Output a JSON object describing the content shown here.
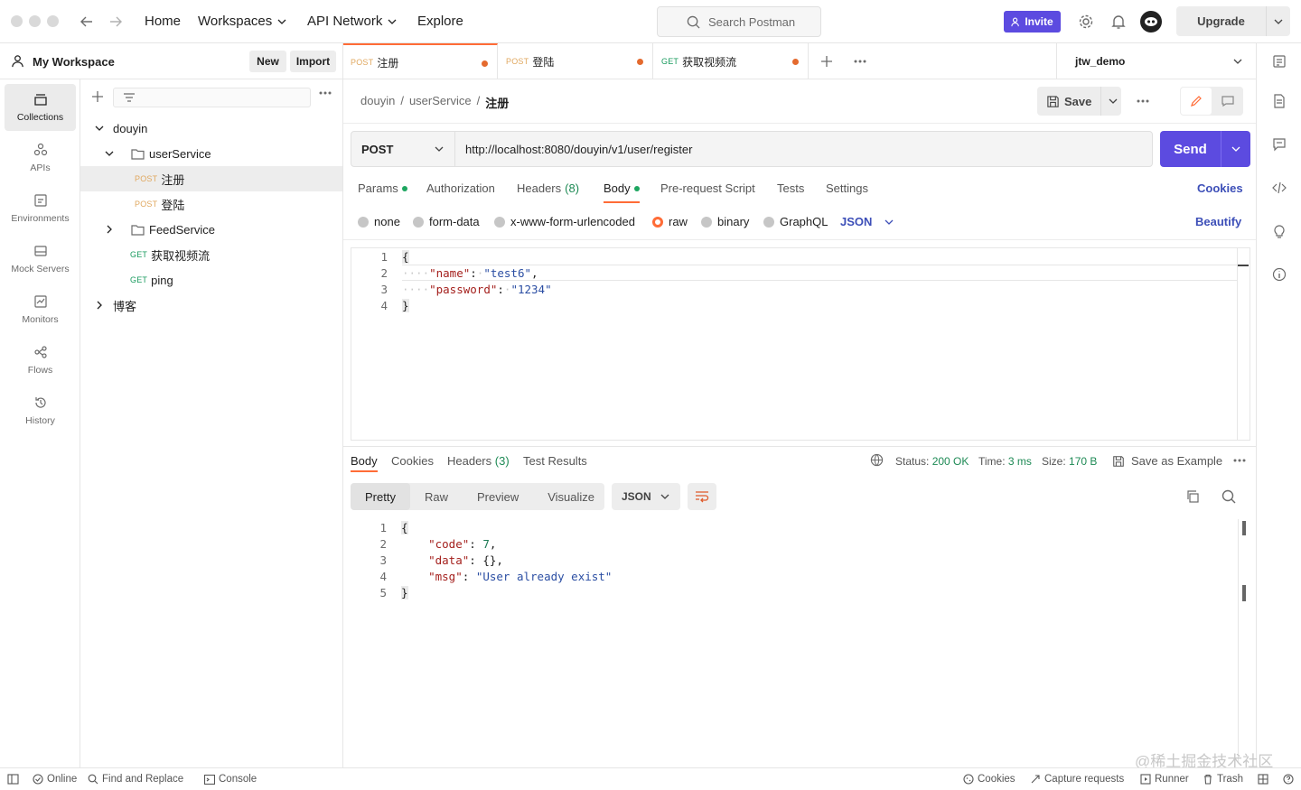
{
  "topbar": {
    "nav": [
      "Home",
      "Workspaces",
      "API Network",
      "Explore"
    ],
    "search_placeholder": "Search Postman",
    "invite_label": "Invite",
    "upgrade_label": "Upgrade"
  },
  "workspace": {
    "name": "My Workspace",
    "new_label": "New",
    "import_label": "Import"
  },
  "rail": [
    {
      "label": "Collections",
      "icon": "collections-icon"
    },
    {
      "label": "APIs",
      "icon": "apis-icon"
    },
    {
      "label": "Environments",
      "icon": "environments-icon"
    },
    {
      "label": "Mock Servers",
      "icon": "mock-servers-icon"
    },
    {
      "label": "Monitors",
      "icon": "monitors-icon"
    },
    {
      "label": "Flows",
      "icon": "flows-icon"
    },
    {
      "label": "History",
      "icon": "history-icon"
    }
  ],
  "tree": {
    "collection": "douyin",
    "folder1": "userService",
    "item1": {
      "method": "POST",
      "name": "注册"
    },
    "item2": {
      "method": "POST",
      "name": "登陆"
    },
    "folder2": "FeedService",
    "item3": {
      "method": "GET",
      "name": "获取视频流"
    },
    "item4": {
      "method": "GET",
      "name": "ping"
    },
    "collection2": "博客"
  },
  "tabs": [
    {
      "method": "POST",
      "name": "注册"
    },
    {
      "method": "POST",
      "name": "登陆"
    },
    {
      "method": "GET",
      "name": "获取视频流"
    }
  ],
  "environment": "jtw_demo",
  "breadcrumb": {
    "a": "douyin",
    "sep": "/",
    "b": "userService",
    "c": "注册"
  },
  "save_label": "Save",
  "request": {
    "method": "POST",
    "url": "http://localhost:8080/douyin/v1/user/register",
    "send_label": "Send"
  },
  "request_tabs": {
    "params": "Params",
    "authorization": "Authorization",
    "headers": "Headers",
    "headers_count": "(8)",
    "body": "Body",
    "prerequest": "Pre-request Script",
    "tests": "Tests",
    "settings": "Settings",
    "cookies": "Cookies"
  },
  "body_types": {
    "none": "none",
    "form_data": "form-data",
    "urlencoded": "x-www-form-urlencoded",
    "raw": "raw",
    "binary": "binary",
    "graphql": "GraphQL",
    "json": "JSON",
    "beautify": "Beautify"
  },
  "request_body": {
    "line_numbers": [
      "1",
      "2",
      "3",
      "4"
    ],
    "open": "{",
    "k1": "\"name\"",
    "v1": "\"test6\"",
    "k2": "\"password\"",
    "v2": "\"1234\"",
    "close": "}"
  },
  "response_tabs": {
    "body": "Body",
    "cookies": "Cookies",
    "headers": "Headers",
    "headers_count": "(3)",
    "test_results": "Test Results"
  },
  "response_meta": {
    "status_label": "Status:",
    "status_value": "200 OK",
    "time_label": "Time:",
    "time_value": "3 ms",
    "size_label": "Size:",
    "size_value": "170 B",
    "save_example": "Save as Example"
  },
  "response_view": {
    "pretty": "Pretty",
    "raw": "Raw",
    "preview": "Preview",
    "visualize": "Visualize",
    "format": "JSON"
  },
  "response_body": {
    "line_numbers": [
      "1",
      "2",
      "3",
      "4",
      "5"
    ],
    "open": "{",
    "k1": "\"code\"",
    "v1": "7",
    "k2": "\"data\"",
    "v2": "{}",
    "k3": "\"msg\"",
    "v3": "\"User already exist\"",
    "close": "}"
  },
  "statusbar": {
    "online": "Online",
    "find_replace": "Find and Replace",
    "console": "Console",
    "cookies": "Cookies",
    "capture": "Capture requests",
    "runner": "Runner",
    "trash": "Trash"
  },
  "watermark": "@稀土掘金技术社区",
  "colors": {
    "accent": "#5c4be0",
    "tab_active": "#ff6c37",
    "status_ok": "#1e8a55",
    "post": "#e0a860",
    "get": "#1a9b5f"
  }
}
